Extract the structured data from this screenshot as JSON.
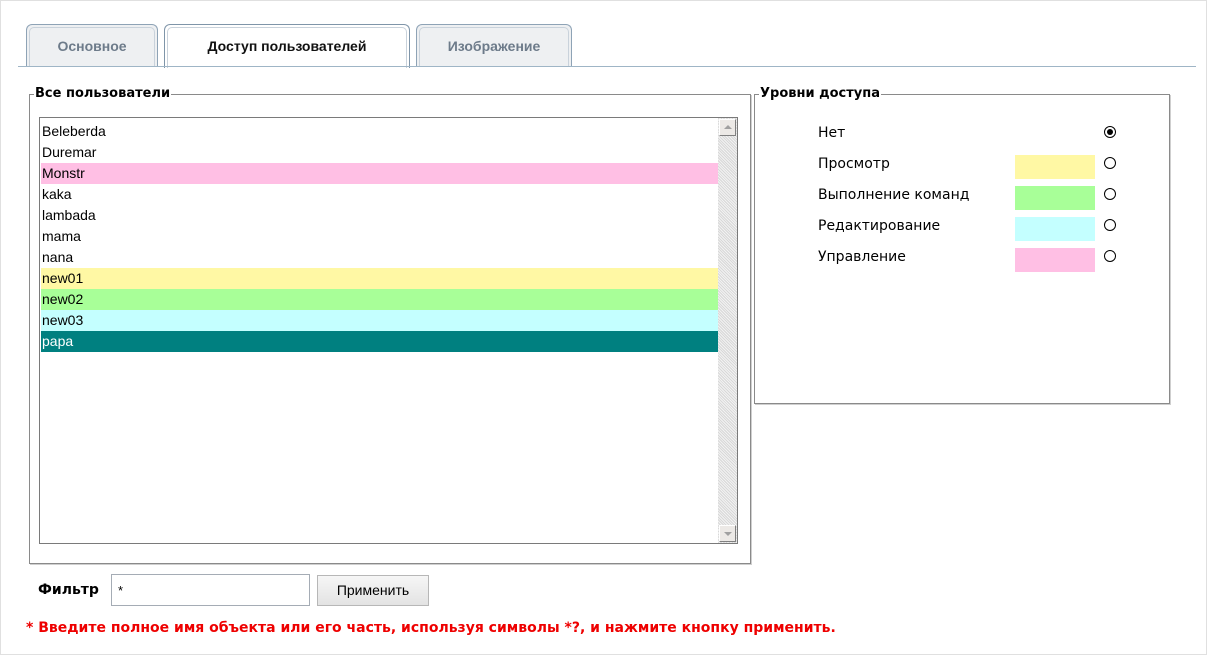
{
  "tabs": [
    {
      "label": "Основное",
      "active": false
    },
    {
      "label": "Доступ пользователей",
      "active": true
    },
    {
      "label": "Изображение",
      "active": false
    }
  ],
  "users_group": {
    "legend": "Все пользователи",
    "users": [
      {
        "name": "Beleberda",
        "bg": "#ffffff",
        "fg": "#000000"
      },
      {
        "name": "Duremar",
        "bg": "#ffffff",
        "fg": "#000000"
      },
      {
        "name": "Monstr",
        "bg": "#ffbfe4",
        "fg": "#000000"
      },
      {
        "name": "kaka",
        "bg": "#ffffff",
        "fg": "#000000"
      },
      {
        "name": "lambada",
        "bg": "#ffffff",
        "fg": "#000000"
      },
      {
        "name": "mama",
        "bg": "#ffffff",
        "fg": "#000000"
      },
      {
        "name": "nana",
        "bg": "#ffffff",
        "fg": "#000000"
      },
      {
        "name": "new01",
        "bg": "#fff8a4",
        "fg": "#000000"
      },
      {
        "name": "new02",
        "bg": "#a8ff98",
        "fg": "#000000"
      },
      {
        "name": "new03",
        "bg": "#c4ffff",
        "fg": "#000000"
      },
      {
        "name": "papa",
        "bg": "#008080",
        "fg": "#ffffff",
        "selected": true
      }
    ]
  },
  "levels_group": {
    "legend": "Уровни доступа",
    "levels": [
      {
        "label": "Нет",
        "color": "",
        "checked": true
      },
      {
        "label": "Просмотр",
        "color": "#fff8a4",
        "checked": false
      },
      {
        "label": "Выполнение команд",
        "color": "#a8ff98",
        "checked": false
      },
      {
        "label": "Редактирование",
        "color": "#c4ffff",
        "checked": false
      },
      {
        "label": "Управление",
        "color": "#ffbfe4",
        "checked": false
      }
    ]
  },
  "filter": {
    "label": "Фильтр",
    "value": "*",
    "button": "Применить",
    "hint": "* Введите полное имя объекта или его часть, используя символы *?, и нажмите кнопку применить."
  }
}
